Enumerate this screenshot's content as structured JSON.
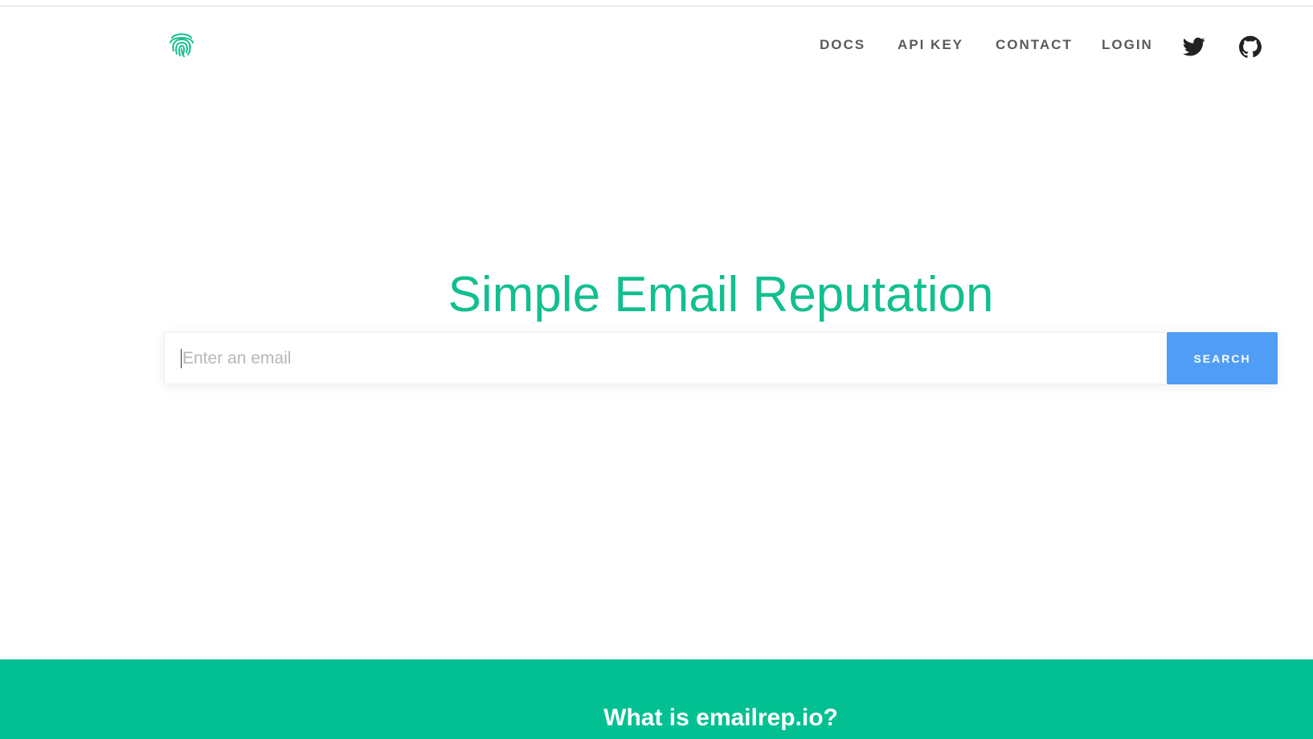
{
  "brand": {
    "logo_icon": "fingerprint-icon",
    "accent_color": "#13bf8e"
  },
  "nav": {
    "docs": "DOCS",
    "api_key": "API KEY",
    "contact": "CONTACT",
    "login": "LOGIN",
    "twitter_icon": "twitter-icon",
    "github_icon": "github-icon"
  },
  "hero": {
    "title": "Simple Email Reputation"
  },
  "search": {
    "placeholder": "Enter an email",
    "value": "",
    "button_label": "SEARCH",
    "button_color": "#4f9df5"
  },
  "footer": {
    "title": "What is emailrep.io?",
    "band_color": "#03c092"
  }
}
